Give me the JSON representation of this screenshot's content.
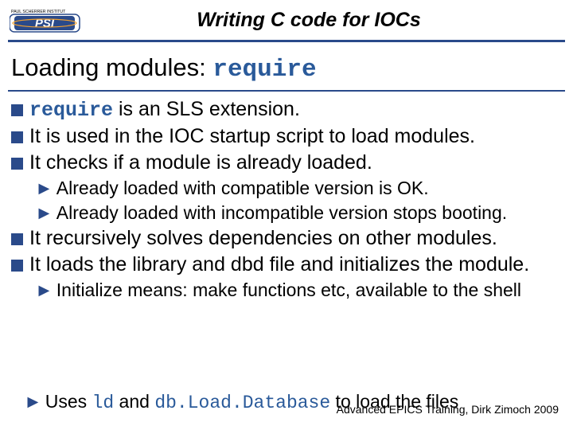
{
  "header": {
    "institute_line": "PAUL SCHERRER INSTITUT",
    "logo_letters": "PSI",
    "title": "Writing C code for IOCs"
  },
  "subtitle": {
    "prefix": "Loading modules: ",
    "keyword": "require"
  },
  "bullets": {
    "b1_code": "require",
    "b1_rest": " is an SLS extension.",
    "b2": "It is used in the IOC startup script to load modules.",
    "b3": "It checks if a module is already loaded.",
    "b3a": "Already loaded with compatible version is OK.",
    "b3b": "Already loaded with incompatible version stops booting.",
    "b4": "It recursively solves dependencies on other modules.",
    "b5": "It loads the library and dbd file and initializes the module.",
    "b5a": "Initialize means: make functions etc, available to the shell",
    "b5b_pre": "Uses ",
    "b5b_code1": "ld",
    "b5b_mid": " and ",
    "b5b_code2": "db.Load.Database",
    "b5b_post": " to load the files"
  },
  "footer": {
    "left": "Advanced EPICS Training,",
    "right": "Dirk Zimoch 2009"
  }
}
